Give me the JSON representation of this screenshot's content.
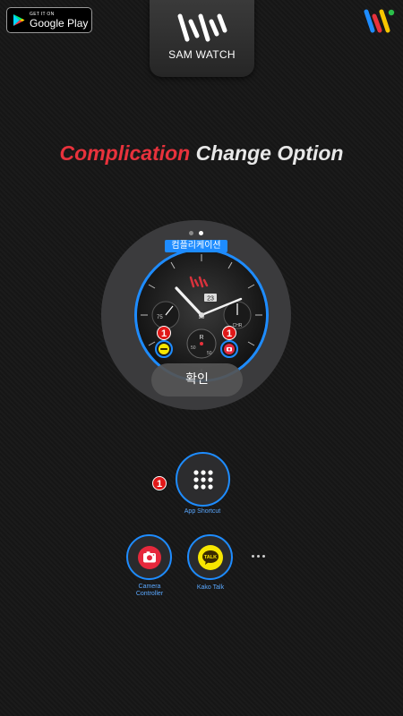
{
  "store_badge": {
    "small_text": "GET IT ON",
    "big_text": "Google Play"
  },
  "brand": {
    "name": "SAM WATCH"
  },
  "heading": {
    "part1": "Complication",
    "part2": "Change Option"
  },
  "colors": {
    "accent_red": "#e8323c",
    "accent_blue": "#1e8cff",
    "badge_red": "#e01818",
    "kakao_yellow": "#f7e600",
    "camera_red": "#e6283c"
  },
  "watch_preview": {
    "complication_tag": "컴플리케이션",
    "confirm_label": "확인",
    "page_dots": {
      "count": 2,
      "active": 1
    },
    "date_value": "23",
    "left_subdial_value": "75",
    "center_subdial_value": "25",
    "lower_subdial_label": "R",
    "lower_subdial_values": [
      "50",
      "50"
    ],
    "chrono_label": "CHR"
  },
  "shortcuts": {
    "app_shortcut": {
      "label": "App Shortcut",
      "icon": "grid-dots-icon",
      "badge": "1"
    },
    "camera_controller": {
      "label_line1": "Camera",
      "label_line2": "Controller",
      "icon": "camera-icon"
    },
    "kakao_talk": {
      "label": "Kako Talk",
      "icon": "kakao-talk-icon",
      "icon_text": "TALK"
    },
    "more_icon": "more-dots-icon"
  }
}
